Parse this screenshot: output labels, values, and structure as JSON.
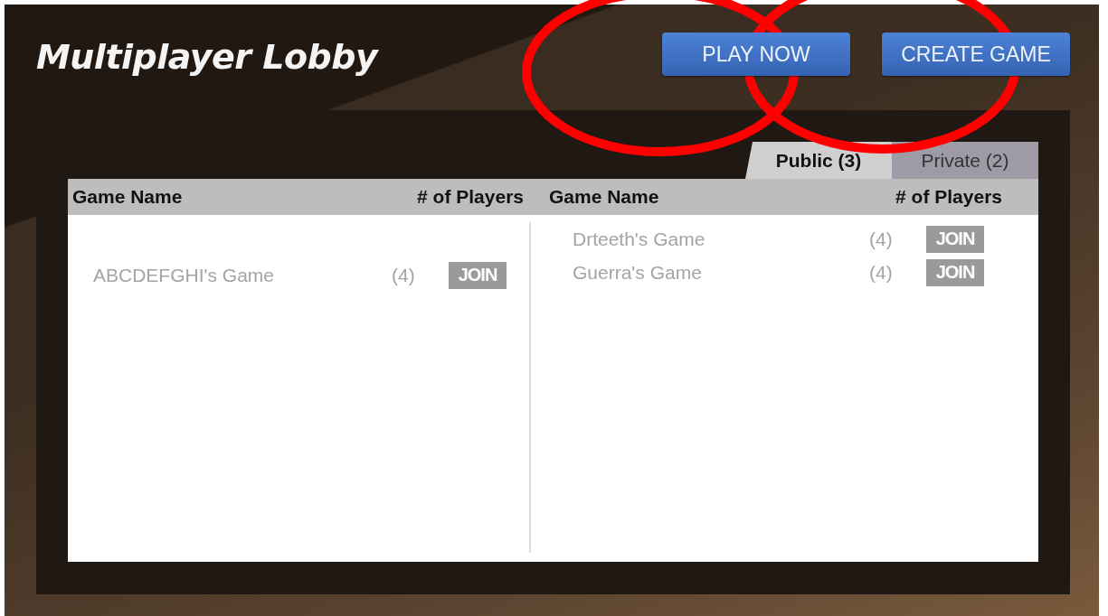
{
  "title": "Multiplayer Lobby",
  "buttons": [
    {
      "label": "PLAY NOW"
    },
    {
      "label": "CREATE GAME"
    }
  ],
  "tabs": [
    {
      "label": "Public (3)",
      "selected": true
    },
    {
      "label": "Private (2)",
      "selected": false
    }
  ],
  "panes": [
    {
      "columns": [
        "Game Name",
        "# of Players"
      ],
      "rows": [
        {
          "name": "ABCDEFGHI's Game",
          "players": "(4)",
          "action": "JOIN",
          "disabled": true
        }
      ]
    },
    {
      "columns": [
        "Game Name",
        "# of Players"
      ],
      "rows": [
        {
          "name": "Drteeth's Game",
          "players": "(4)",
          "action": "JOIN",
          "disabled": true
        },
        {
          "name": "Guerra's Game",
          "players": "(4)",
          "action": "JOIN",
          "disabled": true
        }
      ]
    }
  ],
  "annotations": [
    {
      "kind": "circle"
    },
    {
      "kind": "circle"
    }
  ]
}
